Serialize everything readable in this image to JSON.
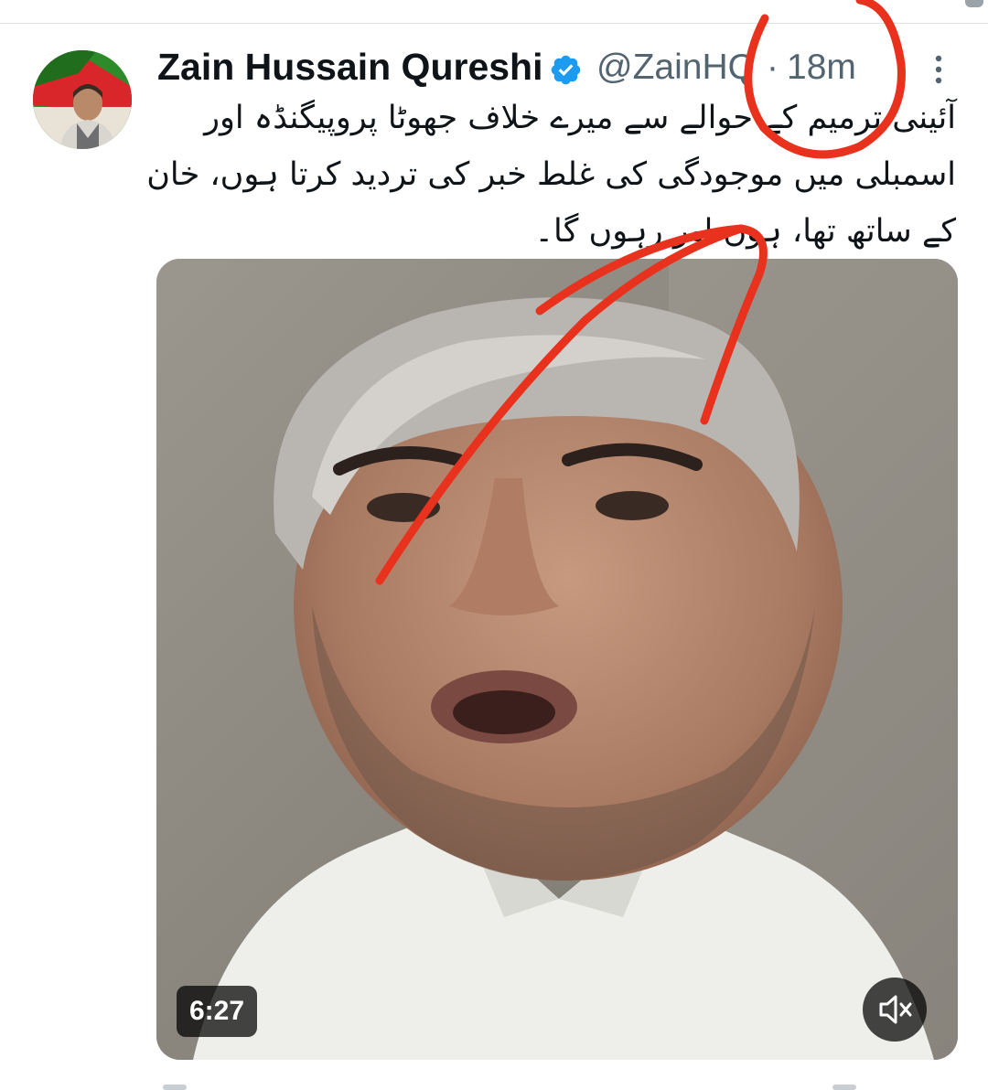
{
  "tweet": {
    "display_name": "Zain Hussain Qureshi",
    "handle": "@ZainHQ",
    "separator": "·",
    "timestamp": "18m",
    "text": "آئینی ترمیم کے حوالے سے میرے خلاف جھوٹا پروپیگنڈہ اور اسمبلی میں موجودگی کی غلط خبر کی تردید کرتا ہوں، خان کے ساتھ تھا، ہوں اور رہوں گا۔",
    "verified": true
  },
  "media": {
    "duration": "6:27",
    "muted": true
  },
  "icons": {
    "verified": "verified-badge-icon",
    "more": "more-vertical-icon",
    "mute": "speaker-muted-icon"
  },
  "colors": {
    "text_primary": "#0f1419",
    "text_secondary": "#536471",
    "verified_blue": "#1d9bf0",
    "annotation_red": "#e8321e"
  }
}
